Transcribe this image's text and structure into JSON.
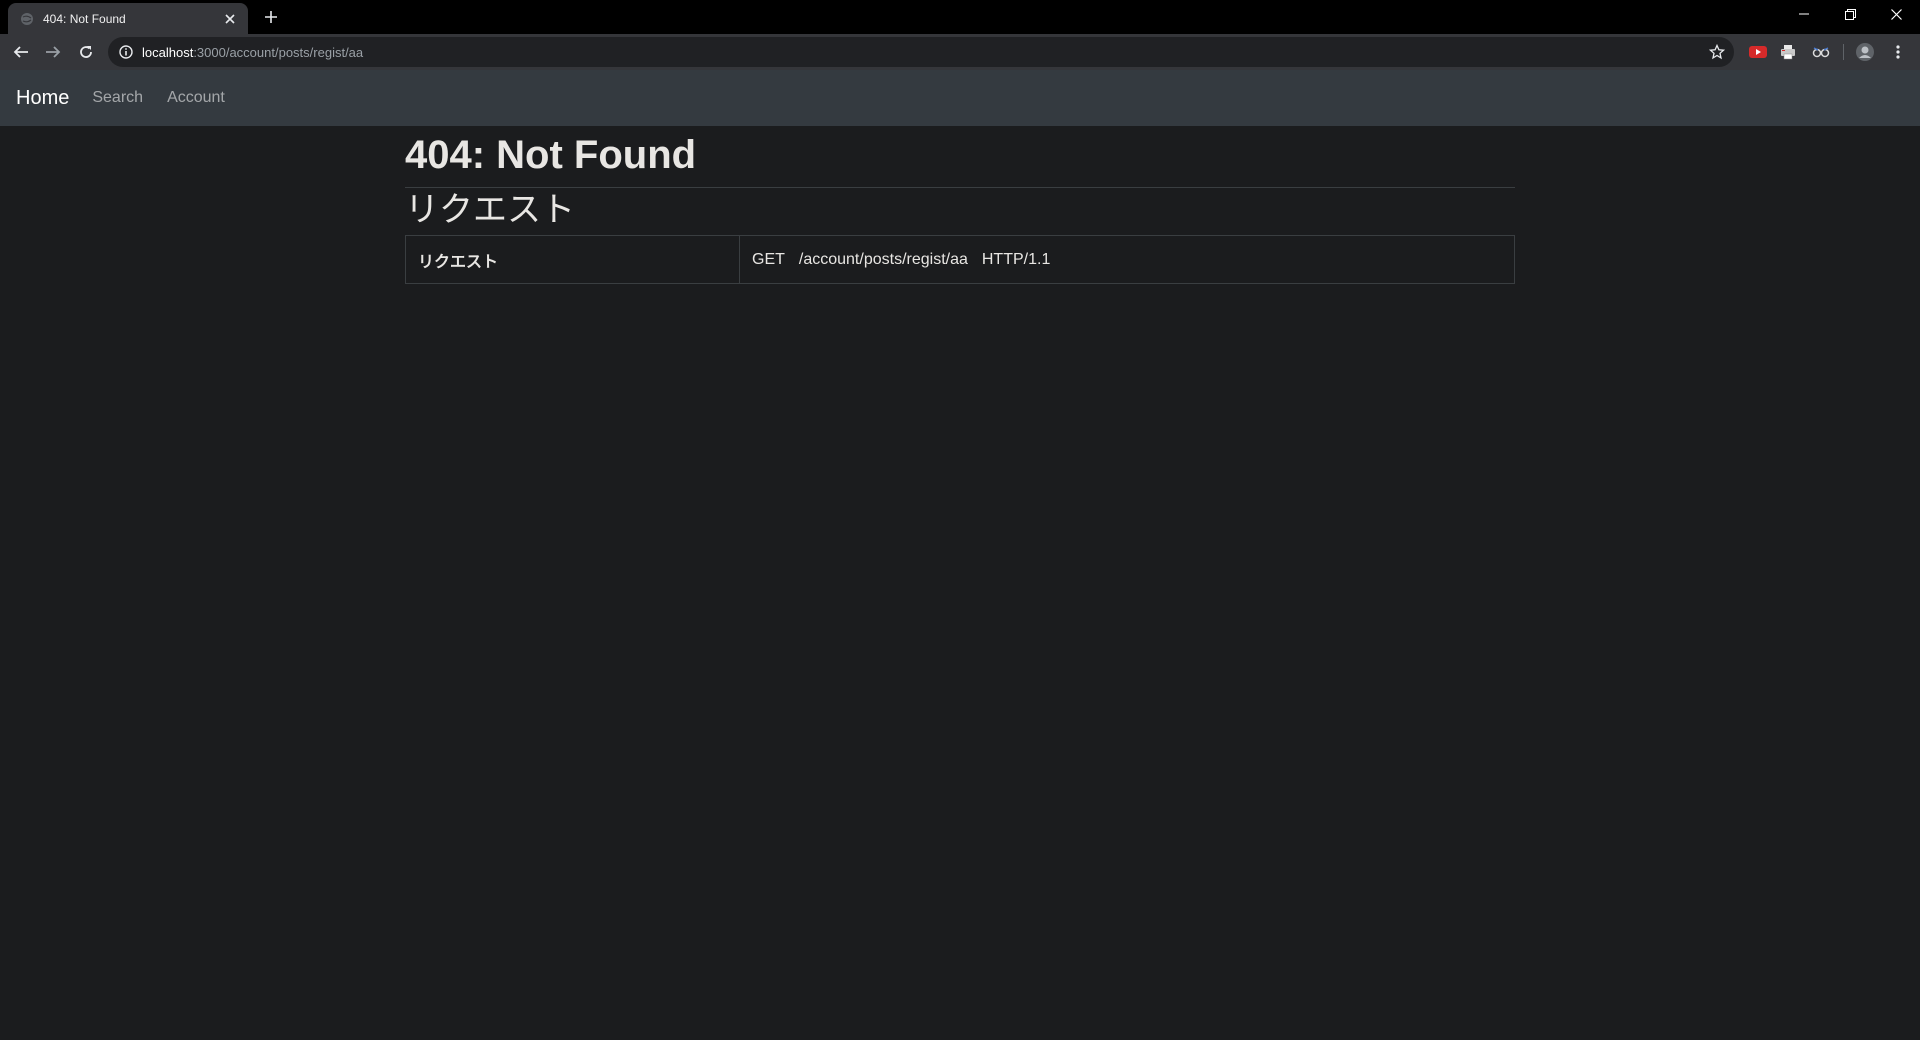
{
  "browser": {
    "tab": {
      "title": "404: Not Found",
      "favicon": "globe-icon"
    },
    "url": {
      "host": "localhost",
      "rest": ":3000/account/posts/regist/aa"
    },
    "extensions": [
      "youtube-extension-icon",
      "printer-extension-icon",
      "glasses-extension-icon",
      "profile-avatar-icon"
    ]
  },
  "navbar": {
    "brand": "Home",
    "links": [
      "Search",
      "Account"
    ]
  },
  "page": {
    "title": "404: Not Found",
    "section_heading": "リクエスト",
    "table": {
      "key": "リクエスト",
      "method": "GET",
      "path": "/account/posts/regist/aa",
      "protocol": "HTTP/1.1"
    }
  },
  "colors": {
    "background": "#1b1c1e",
    "navbar": "#343a40",
    "tabstrip": "#000000",
    "toolbar": "#35363a"
  }
}
